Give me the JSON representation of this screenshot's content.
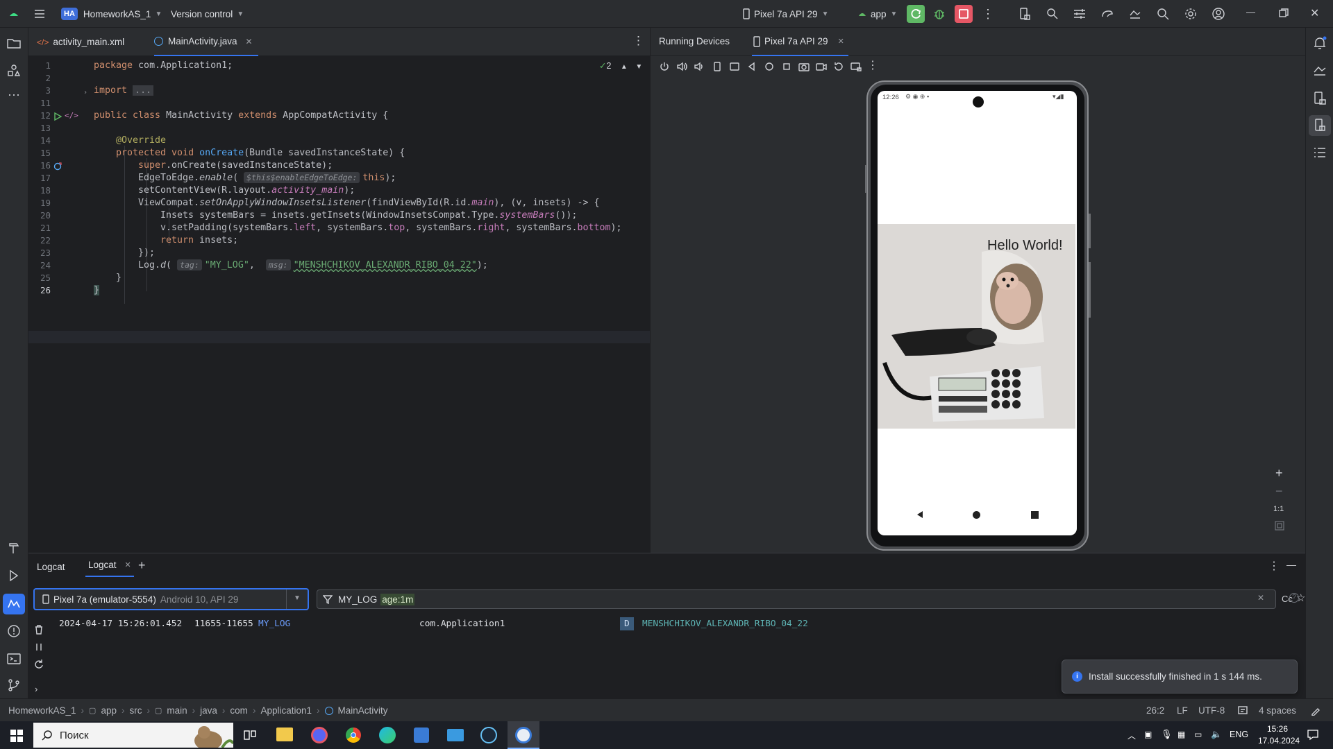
{
  "titlebar": {
    "project_badge": "HA",
    "project_name": "HomeworkAS_1",
    "vcs": "Version control",
    "device": "Pixel 7a API 29",
    "run_config": "app"
  },
  "editor": {
    "tabs": [
      {
        "label": "activity_main.xml"
      },
      {
        "label": "MainActivity.java"
      }
    ],
    "warnings_count": "2",
    "line_numbers": [
      "1",
      "2",
      "3",
      "11",
      "12",
      "13",
      "14",
      "15",
      "16",
      "17",
      "18",
      "19",
      "20",
      "21",
      "22",
      "23",
      "24",
      "25",
      "26"
    ],
    "lines": {
      "l1_kw": "package",
      "l1_rest": " com.Application1;",
      "l3_kw": "import",
      "l3_fold": "...",
      "l12_a": "public class",
      "l12_b": " MainActivity ",
      "l12_c": "extends",
      "l12_d": " AppCompatActivity {",
      "l14": "@Override",
      "l15_a": "protected void",
      "l15_b": "onCreate",
      "l15_c": "(Bundle savedInstanceState) {",
      "l16_a": "super",
      "l16_b": ".onCreate(savedInstanceState);",
      "l17_a": "EdgeToEdge.",
      "l17_b": "enable",
      "l17_c": "(",
      "l17_hint": "$this$enableEdgeToEdge:",
      "l17_d": "this",
      "l17_e": ");",
      "l18_a": "setContentView(R.layout.",
      "l18_b": "activity_main",
      "l18_c": ");",
      "l19_a": "ViewCompat.",
      "l19_b": "setOnApplyWindowInsetsListener",
      "l19_c": "(findViewById(R.id.",
      "l19_d": "main",
      "l19_e": "), (v, insets) -> {",
      "l20_a": "Insets systemBars = insets.getInsets(WindowInsetsCompat.Type.",
      "l20_b": "systemBars",
      "l20_c": "());",
      "l21_a": "v.setPadding(systemBars.",
      "l21_b": "left",
      "l21_c": ", systemBars.",
      "l21_d": "top",
      "l21_e": ", systemBars.",
      "l21_f": "right",
      "l21_g": ", systemBars.",
      "l21_h": "bottom",
      "l21_i": ");",
      "l22_a": "return",
      "l22_b": " insets;",
      "l23": "});",
      "l24_a": "Log.",
      "l24_b": "d",
      "l24_c": "(",
      "l24_hint1": "tag:",
      "l24_d": "\"MY_LOG\"",
      "l24_e": ", ",
      "l24_hint2": "msg:",
      "l24_f": "\"MENSHCHIKOV_ALEXANDR_RIBO_04_22\"",
      "l24_g": ");",
      "l25": "}",
      "l26": "}"
    }
  },
  "running_devices": {
    "title": "Running Devices",
    "device_tab": "Pixel 7a API 29",
    "phone_time": "12:26",
    "hello": "Hello World!",
    "zoom_label": "1:1"
  },
  "logcat": {
    "tabs": [
      "Logcat",
      "Logcat"
    ],
    "device_select": "Pixel 7a (emulator-5554)",
    "device_select_sub": "Android 10, API 29",
    "filter_tag": "MY_LOG",
    "filter_age": "age:1m",
    "case_btn": "Cc",
    "row": {
      "datetime": "2024-04-17 15:26:01.452",
      "pid": "11655-11655",
      "tag": "MY_LOG",
      "package": "com.Application1",
      "level": "D",
      "message": "MENSHCHIKOV_ALEXANDR_RIBO_04_22"
    }
  },
  "toast": {
    "message": "Install successfully finished in 1 s 144 ms."
  },
  "statusbar": {
    "breadcrumb": [
      "HomeworkAS_1",
      "app",
      "src",
      "main",
      "java",
      "com",
      "Application1",
      "MainActivity"
    ],
    "position": "26:2",
    "line_sep": "LF",
    "encoding": "UTF-8",
    "indent": "4 spaces"
  },
  "taskbar": {
    "search_placeholder": "Поиск",
    "lang": "ENG",
    "time": "15:26",
    "date": "17.04.2024"
  },
  "colors": {
    "accent": "#3574f0",
    "run_green": "#5fb865",
    "stop_red": "#e55765",
    "logcat_tag": "#6b9bfa",
    "message_green": "#5eb4b4"
  }
}
